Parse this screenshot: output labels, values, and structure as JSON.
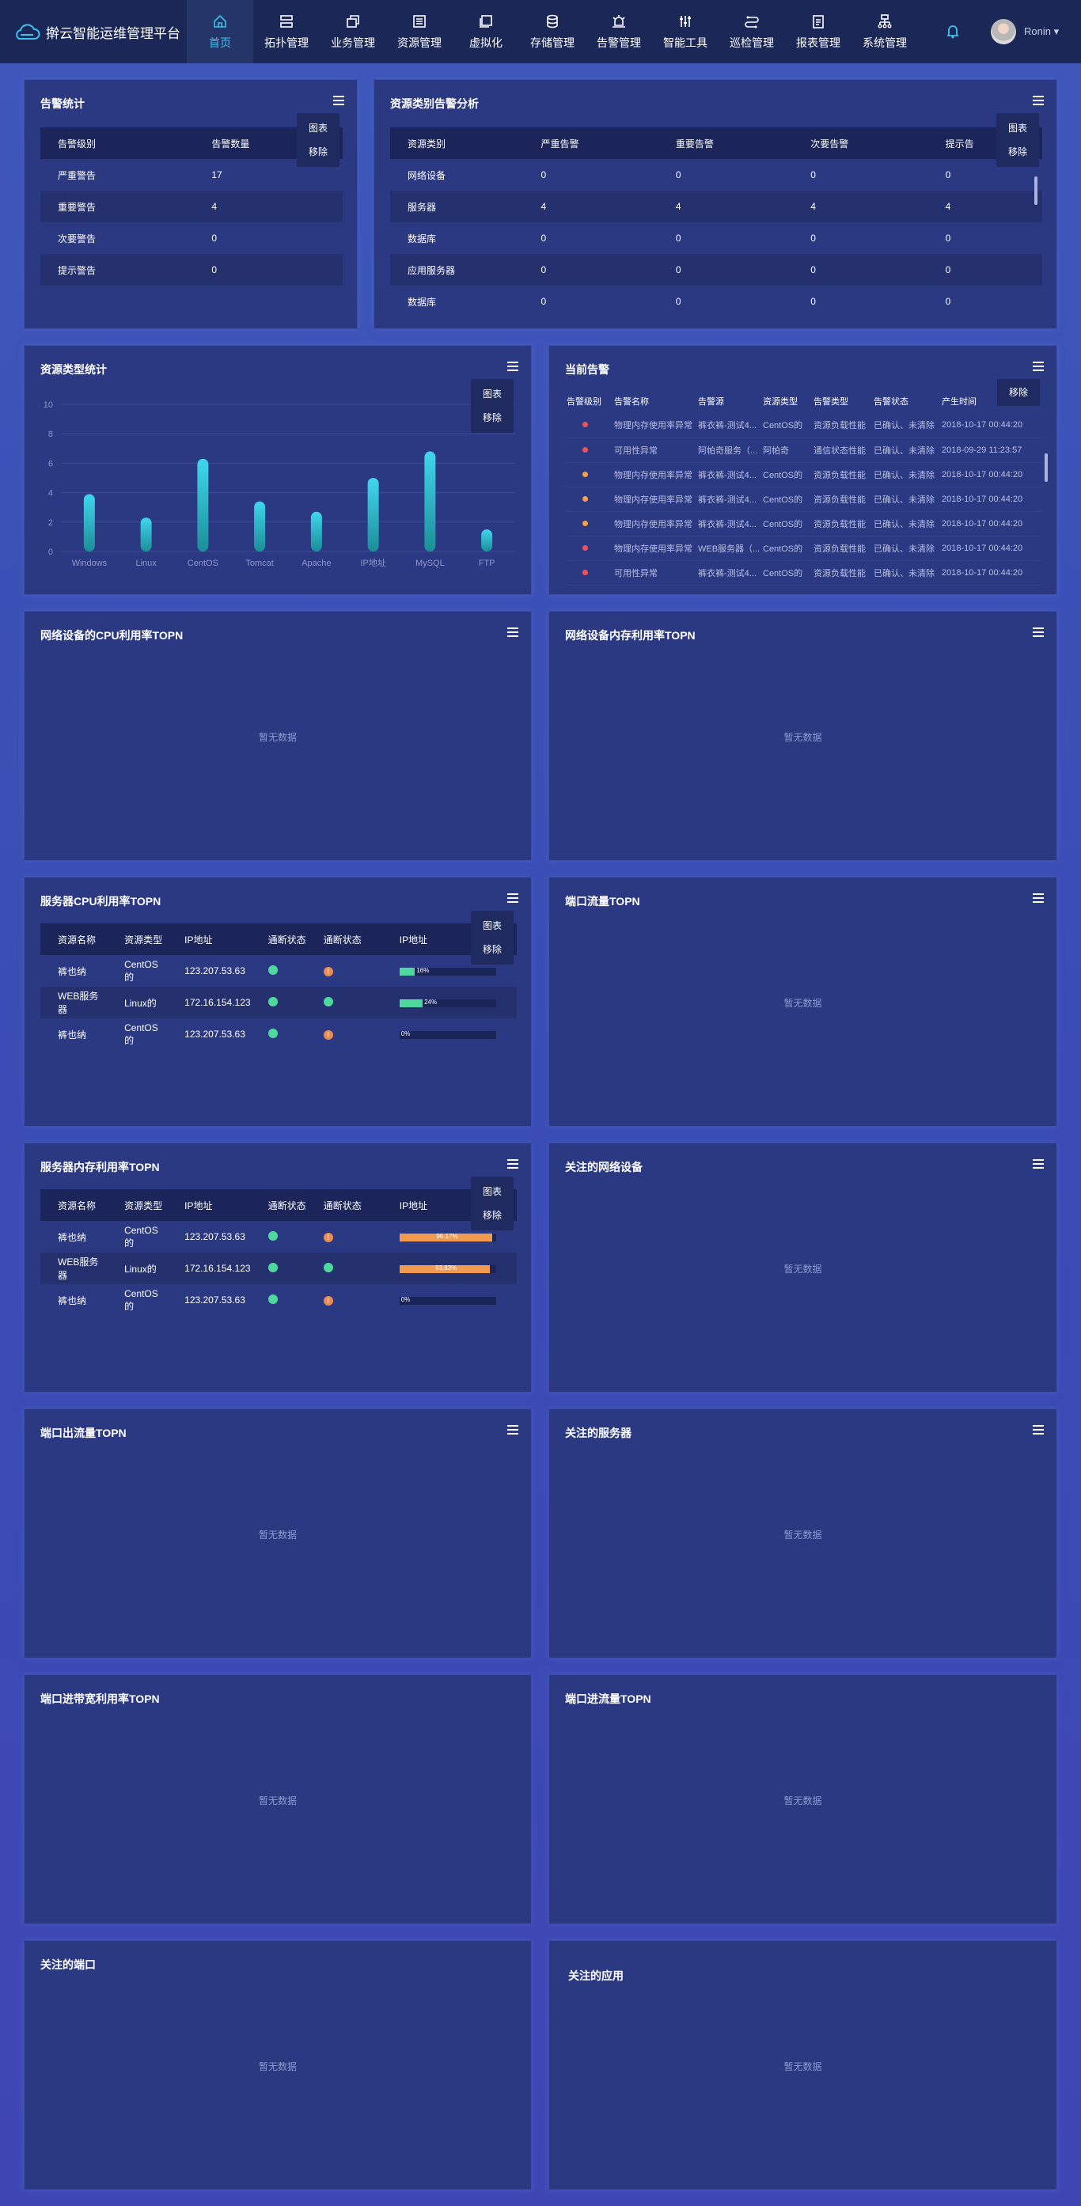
{
  "app": {
    "title": "擀云智能运维管理平台"
  },
  "nav": [
    {
      "label": "首页",
      "icon": "home-icon",
      "active": true
    },
    {
      "label": "拓扑管理",
      "icon": "topology-icon"
    },
    {
      "label": "业务管理",
      "icon": "business-icon"
    },
    {
      "label": "资源管理",
      "icon": "resource-icon"
    },
    {
      "label": "虚拟化",
      "icon": "virtualization-icon"
    },
    {
      "label": "存储管理",
      "icon": "storage-icon"
    },
    {
      "label": "告警管理",
      "icon": "alarm-icon"
    },
    {
      "label": "智能工具",
      "icon": "tools-icon"
    },
    {
      "label": "巡检管理",
      "icon": "inspection-icon"
    },
    {
      "label": "报表管理",
      "icon": "report-icon"
    },
    {
      "label": "系统管理",
      "icon": "system-icon"
    }
  ],
  "user": {
    "name": "Ronin ▾"
  },
  "menu": {
    "chart": "图表",
    "remove": "移除"
  },
  "nodata": "暂无数据",
  "alarm_stats": {
    "title": "告警统计",
    "headers": [
      "告警级别",
      "告警数量"
    ],
    "rows": [
      [
        "严重警告",
        "17"
      ],
      [
        "重要警告",
        "4"
      ],
      [
        "次要警告",
        "0"
      ],
      [
        "提示警告",
        "0"
      ]
    ]
  },
  "resource_alarm": {
    "title": "资源类别告警分析",
    "headers": [
      "资源类别",
      "严重告警",
      "重要告警",
      "次要告警",
      "提示告"
    ],
    "rows": [
      [
        "网络设备",
        "0",
        "0",
        "0",
        "0"
      ],
      [
        "服务器",
        "4",
        "4",
        "4",
        "4"
      ],
      [
        "数据库",
        "0",
        "0",
        "0",
        "0"
      ],
      [
        "应用服务器",
        "0",
        "0",
        "0",
        "0"
      ],
      [
        "数据库",
        "0",
        "0",
        "0",
        "0"
      ]
    ]
  },
  "resource_type": {
    "title": "资源类型统计"
  },
  "chart_data": {
    "type": "bar",
    "categories": [
      "Windows",
      "Linux",
      "CentOS",
      "Tomcat",
      "Apache",
      "IP地址",
      "MySQL",
      "FTP"
    ],
    "values": [
      3.9,
      2.3,
      6.3,
      3.4,
      2.7,
      5.0,
      6.8,
      1.5
    ],
    "ylim": [
      0,
      10
    ],
    "yticks": [
      0,
      2,
      4,
      6,
      8,
      10
    ],
    "grid": true,
    "colors": [
      "#40d6ee",
      "#1c8e98"
    ]
  },
  "current_alarm": {
    "title": "当前告警",
    "headers": [
      "告警级别",
      "告警名称",
      "告警源",
      "资源类型",
      "告警类型",
      "告警状态",
      "产生时间"
    ],
    "rows": [
      {
        "level": "red",
        "name": "物理内存使用率异常",
        "source": "裤衣裤-测试4...",
        "type": "CentOS的",
        "atype": "资源负载性能",
        "status": "已确认、未清除",
        "time": "2018-10-17 00:44:20"
      },
      {
        "level": "red",
        "name": "可用性异常",
        "source": "阿帕奇服务（...",
        "type": "阿帕奇",
        "atype": "通信状态性能",
        "status": "已确认、未清除",
        "time": "2018-09-29 11:23:57"
      },
      {
        "level": "orange",
        "name": "物理内存使用率异常",
        "source": "裤衣裤-测试4...",
        "type": "CentOS的",
        "atype": "资源负载性能",
        "status": "已确认、未清除",
        "time": "2018-10-17 00:44:20"
      },
      {
        "level": "orange",
        "name": "物理内存使用率异常",
        "source": "裤衣裤-测试4...",
        "type": "CentOS的",
        "atype": "资源负载性能",
        "status": "已确认、未清除",
        "time": "2018-10-17 00:44:20"
      },
      {
        "level": "orange",
        "name": "物理内存使用率异常",
        "source": "裤衣裤-测试4...",
        "type": "CentOS的",
        "atype": "资源负载性能",
        "status": "已确认、未清除",
        "time": "2018-10-17 00:44:20"
      },
      {
        "level": "red",
        "name": "物理内存使用率异常",
        "source": "WEB服务器（...",
        "type": "CentOS的",
        "atype": "资源负载性能",
        "status": "已确认、未清除",
        "time": "2018-10-17 00:44:20"
      },
      {
        "level": "red",
        "name": "可用性异常",
        "source": "裤衣裤-测试4...",
        "type": "CentOS的",
        "atype": "资源负载性能",
        "status": "已确认、未清除",
        "time": "2018-10-17 00:44:20"
      }
    ]
  },
  "net_cpu": {
    "title": "网络设备的CPU利用率TOPN"
  },
  "net_mem": {
    "title": "网络设备内存利用率TOPN"
  },
  "srv_cpu": {
    "title": "服务器CPU利用率TOPN",
    "headers": [
      "资源名称",
      "资源类型",
      "IP地址",
      "通断状态",
      "通断状态",
      "IP地址"
    ],
    "rows": [
      {
        "name": "裤也纳",
        "type": "CentOS的",
        "ip": "123.207.53.63",
        "s1": "green",
        "s2": "orange",
        "pct": 0.16,
        "label": "16%",
        "color": "#4ed89e"
      },
      {
        "name": "WEB服务器",
        "type": "Linux的",
        "ip": "172.16.154.123",
        "s1": "green",
        "s2": "green",
        "pct": 0.24,
        "label": "24%",
        "color": "#4ed89e"
      },
      {
        "name": "裤也纳",
        "type": "CentOS的",
        "ip": "123.207.53.63",
        "s1": "green",
        "s2": "orange",
        "pct": 0,
        "label": "0%",
        "color": "#4ed89e"
      }
    ]
  },
  "port_flow": {
    "title": "端口流量TOPN"
  },
  "srv_mem": {
    "title": "服务器内存利用率TOPN",
    "headers": [
      "资源名称",
      "资源类型",
      "IP地址",
      "通断状态",
      "通断状态",
      "IP地址"
    ],
    "rows": [
      {
        "name": "裤也纳",
        "type": "CentOS的",
        "ip": "123.207.53.63",
        "s1": "green",
        "s2": "orange",
        "pct": 0.96,
        "label": "96.17%",
        "color": "#f29a4f"
      },
      {
        "name": "WEB服务器",
        "type": "Linux的",
        "ip": "172.16.154.123",
        "s1": "green",
        "s2": "green",
        "pct": 0.94,
        "label": "93.83%",
        "color": "#f29a4f"
      },
      {
        "name": "裤也纳",
        "type": "CentOS的",
        "ip": "123.207.53.63",
        "s1": "green",
        "s2": "orange",
        "pct": 0,
        "label": "0%",
        "color": "#f29a4f"
      }
    ]
  },
  "focus_net": {
    "title": "关注的网络设备"
  },
  "port_out": {
    "title": "端口出流量TOPN"
  },
  "focus_srv": {
    "title": "关注的服务器"
  },
  "port_bw": {
    "title": "端口进带宽利用率TOPN"
  },
  "port_in": {
    "title": "端口进流量TOPN"
  },
  "focus_port": {
    "title": "关注的端口"
  },
  "focus_app": {
    "title": "关注的应用"
  }
}
